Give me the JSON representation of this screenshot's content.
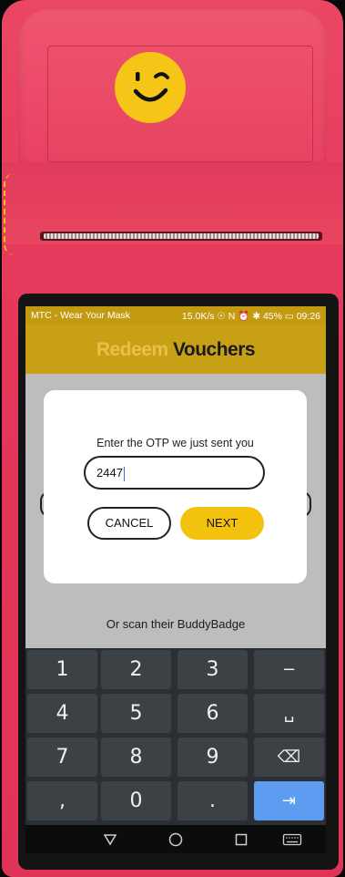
{
  "status_bar": {
    "carrier": "MTC - Wear Your Mask",
    "right": "15.0K/s ☉ N ⏰ ✱ 45% ▭ 09:26"
  },
  "app_header": {
    "title_part1": "Redeem",
    "title_part2": "Vouchers"
  },
  "dialog": {
    "prompt": "Enter the OTP we just sent you",
    "otp_value": "2447",
    "cancel_label": "CANCEL",
    "next_label": "NEXT"
  },
  "background_hint": "Or scan their BuddyBadge",
  "keyboard": {
    "keys": [
      "1",
      "2",
      "3",
      "−",
      "4",
      "5",
      "6",
      "␣",
      "7",
      "8",
      "9",
      "⌫",
      ",",
      "0",
      ".",
      "⇥"
    ]
  },
  "colors": {
    "device": "#e5365a",
    "accent_yellow": "#f3c20f",
    "header_yellow": "#c8a015",
    "keyboard_bg": "#2b2f33",
    "go_key": "#5d9cf0"
  },
  "icons": {
    "nav_back": "triangle-back-icon",
    "nav_home": "circle-home-icon",
    "nav_recents": "square-recents-icon",
    "nav_keyboard": "keyboard-icon",
    "smiley": "wink-smiley-logo"
  }
}
